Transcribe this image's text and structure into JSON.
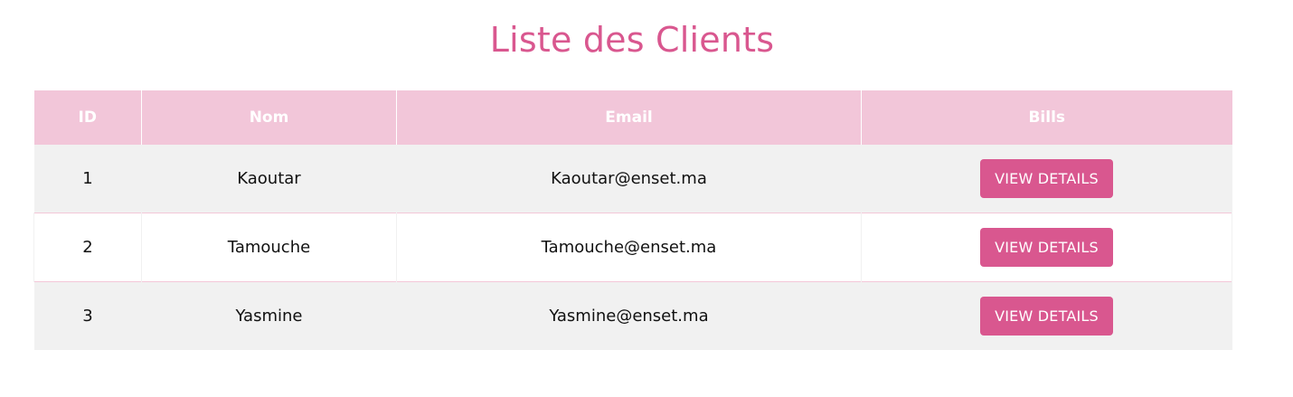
{
  "page": {
    "title": "Liste des Clients"
  },
  "colors": {
    "accent": "#d9578f",
    "header_bg": "#f2c6d9",
    "row_alt_bg": "#f1f1f1"
  },
  "table": {
    "headers": {
      "id": "ID",
      "nom": "Nom",
      "email": "Email",
      "bills": "Bills"
    },
    "rows": [
      {
        "id": "1",
        "nom": "Kaoutar",
        "email": "Kaoutar@enset.ma",
        "action": "VIEW DETAILS"
      },
      {
        "id": "2",
        "nom": "Tamouche",
        "email": "Tamouche@enset.ma",
        "action": "VIEW DETAILS"
      },
      {
        "id": "3",
        "nom": "Yasmine",
        "email": "Yasmine@enset.ma",
        "action": "VIEW DETAILS"
      }
    ]
  }
}
